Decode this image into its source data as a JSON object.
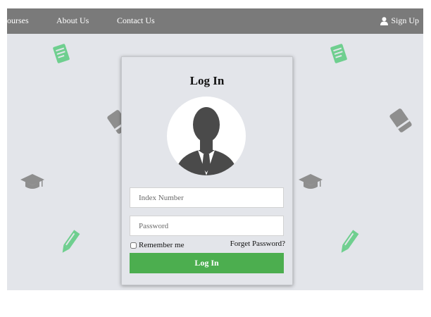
{
  "nav": {
    "courses_label": "Courses",
    "about_label": "About Us",
    "contact_label": "Contact Us",
    "signup_label": "Sign Up"
  },
  "login": {
    "title": "Log In",
    "index_placeholder": "Index Number",
    "password_placeholder": "Password",
    "remember_label": "Remember me",
    "forgot_label": "Forget Password?",
    "button_label": "Log In"
  },
  "colors": {
    "navbar": "#7a7a7a",
    "background": "#e3e5ea",
    "accent_green": "#4cae4f",
    "icon_green": "#6fcf8f",
    "icon_gray": "#8e8e8e"
  },
  "icons": [
    "document-icon",
    "eraser-icon",
    "graduation-cap-icon",
    "pencil-icon",
    "user-icon",
    "avatar-icon"
  ]
}
